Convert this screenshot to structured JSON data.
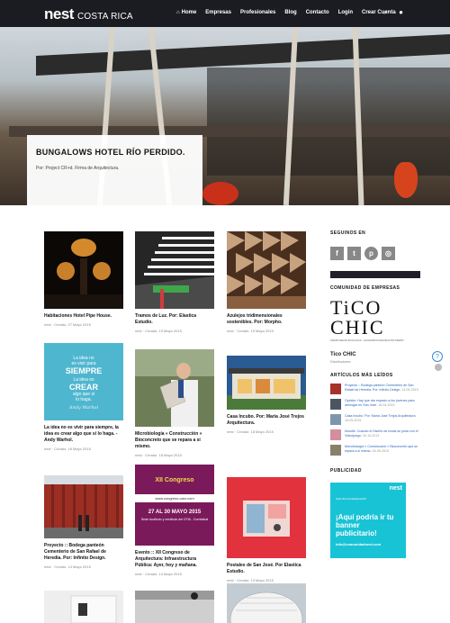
{
  "header": {
    "brand": "nest",
    "region": "COSTA RICA",
    "nav": [
      {
        "label": "Home",
        "active": true
      },
      {
        "label": "Empresas"
      },
      {
        "label": "Profesionales"
      },
      {
        "label": "Blog"
      },
      {
        "label": "Contacto"
      },
      {
        "label": "Login"
      },
      {
        "label": "Crear Cuenta"
      }
    ],
    "icons": [
      "search-icon",
      "user-icon"
    ]
  },
  "hero": {
    "title": "BUNGALOWS HOTEL RÍO PERDIDO.",
    "byline": "Por: Project CR+d. Firma de Arquitectura."
  },
  "posts": [
    {
      "title": "Habitaciones Hotel Pipe House.",
      "author": "nest",
      "date": "Creado: 27 Mayo 2015"
    },
    {
      "title": "Tramos de Luz. Por: Elastica Estudio.",
      "author": "nest",
      "date": "Creado: 19 Mayo 2015"
    },
    {
      "title": "Azulejos tridimensionales sostenibles. Por: Morpho.",
      "author": "nest",
      "date": "Creado: 19 Mayo 2015"
    },
    {
      "title": "La idea no es vivir para siempre, la idea es crear algo que si lo haga. - Andy Warhol.",
      "author": "nest",
      "date": "Creado: 18 Mayo 2015"
    },
    {
      "title": "Microbiología « Construcción » Bioconcreto que se repara a si mismo.",
      "author": "nest",
      "date": "Creado: 18 Mayo 2015"
    },
    {
      "title": "Casa Incubo. Por: María José Trejos Arquitectura.",
      "author": "nest",
      "date": "Creado: 18 Mayo 2015"
    },
    {
      "title": "Proyecto :: Bodega panteón Cementerio de San Rafael de Heredia. Por: Infinito Design.",
      "author": "nest",
      "date": "Creado: 14 Mayo 2015"
    },
    {
      "title": "Evento :: XII Congreso de Arquitectura: Infraestructura Pública: Ayer, hoy y mañana.",
      "author": "nest",
      "date": "Creado: 14 Mayo 2015"
    },
    {
      "title": "Postales de San José. Por Elastica Estudio.",
      "author": "nest",
      "date": "Creado: 13 Mayo 2015"
    }
  ],
  "quote_card": {
    "line1": "La idea no",
    "line2": "es vivir para",
    "line3": "SIEMPRE",
    "line4": "La idea es",
    "line5": "CREAR",
    "line6": "algo que si",
    "line7": "lo haga.",
    "sig": "Andy Warhol"
  },
  "congreso_card": {
    "title": "XII Congreso",
    "site": "www.congreso-cacr.com",
    "dates": "27 AL 30 MAYO 2015",
    "venue": "Sede Auditorio y vestíbulo del CFIA - Curridabat"
  },
  "sidebar": {
    "social_heading": "SEGUINOS EN",
    "social": [
      {
        "icon": "facebook-icon",
        "glyph": "f"
      },
      {
        "icon": "twitter-icon",
        "glyph": "t"
      },
      {
        "icon": "pinterest-icon",
        "glyph": "p"
      },
      {
        "icon": "instagram-icon",
        "glyph": "◎"
      }
    ],
    "companies_heading": "COMUNIDAD DE EMPRESAS",
    "company_logo_line1": "TiCO",
    "company_logo_line2": "CHIC",
    "company_tagline": "DISEÑO MEJOR ECOLOGICO · ACCESORIOS DECORACIÓN DISEÑO",
    "company_name": "Tico CHIC",
    "company_category": "Diseñadores",
    "popular_heading": "ARTÍCULOS MÁS LEÍDOS",
    "popular": [
      {
        "text": "Proyecto :: Bodega panteón Cementerio de San Rafael de Heredia. Por: Infinito Design.",
        "date": "14-05-2015",
        "color": "#a6322b"
      },
      {
        "text": "Opinión: Hay que dar espacio a los jóvenes para arriesgar en San José.",
        "date": "18-04-2015",
        "color": "#4a5563"
      },
      {
        "text": "Casa Incubo. Por: María José Trejos Arquitectura.",
        "date": "18-05-2015",
        "color": "#7f95ad"
      },
      {
        "text": "Moodle: Cuando el Diseño de moda se junta con el Videojuego.",
        "date": "26-10-2013",
        "color": "#d38ea0"
      },
      {
        "text": "Microbiología « Construcción » Bioconcreto que se repara a si mismo.",
        "date": "18-05-2015",
        "color": "#8a7f6d"
      }
    ],
    "ads_heading": "PUBLICIDAD",
    "banner": {
      "brand": "nest",
      "small": "hola! #comunidadnestCR",
      "headline": "¡Aquí podría ir tu banner publicitario!",
      "email": "info@comunidadnest.com"
    }
  },
  "colors": {
    "topbar": "#1b1b22",
    "link": "#2a66b8",
    "banner": "#19c3d6"
  }
}
